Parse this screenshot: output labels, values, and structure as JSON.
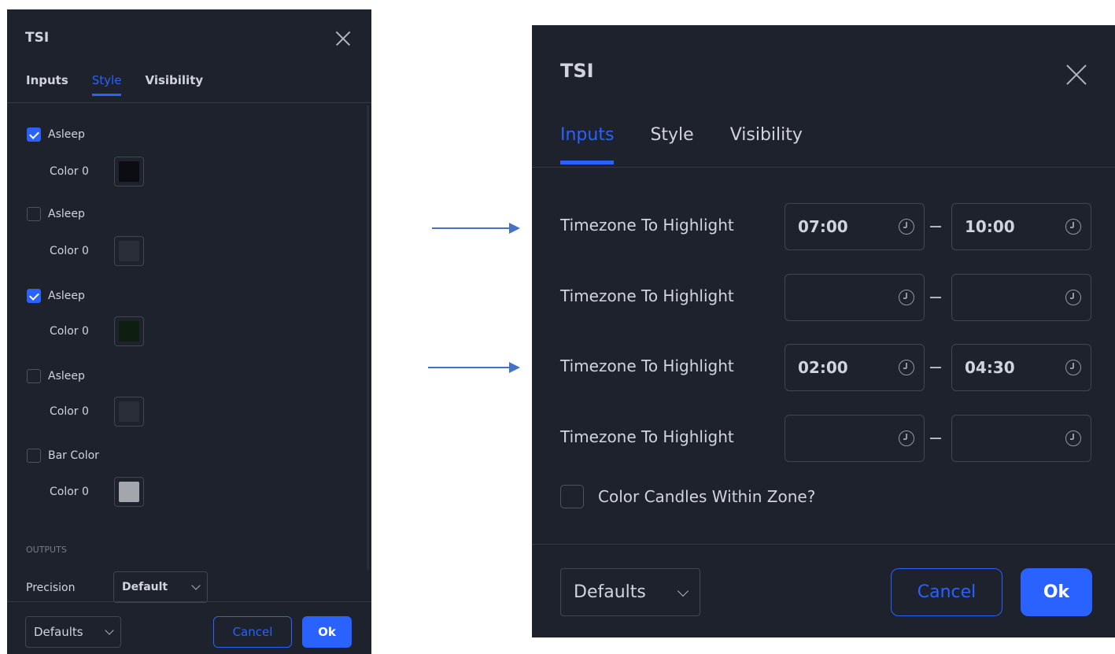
{
  "left_dialog": {
    "title": "TSI",
    "tabs": [
      {
        "label": "Inputs",
        "active": false
      },
      {
        "label": "Style",
        "active": true
      },
      {
        "label": "Visibility",
        "active": false
      }
    ],
    "plots": [
      {
        "label": "Asleep",
        "checked": true,
        "color_label": "Color 0",
        "swatch": "#0b0d12"
      },
      {
        "label": "Asleep",
        "checked": false,
        "color_label": "Color 0",
        "swatch": "#2a2e39"
      },
      {
        "label": "Asleep",
        "checked": true,
        "color_label": "Color 0",
        "swatch": "#0e1f12"
      },
      {
        "label": "Asleep",
        "checked": false,
        "color_label": "Color 0",
        "swatch": "#2a2e39"
      },
      {
        "label": "Bar Color",
        "checked": false,
        "color_label": "Color 0",
        "swatch": "#a3a6ad"
      }
    ],
    "outputs_heading": "OUTPUTS",
    "precision_label": "Precision",
    "precision_value": "Default",
    "footer": {
      "defaults": "Defaults",
      "cancel": "Cancel",
      "ok": "Ok"
    }
  },
  "right_dialog": {
    "title": "TSI",
    "tabs": [
      {
        "label": "Inputs",
        "active": true
      },
      {
        "label": "Style",
        "active": false
      },
      {
        "label": "Visibility",
        "active": false
      }
    ],
    "timezones": [
      {
        "label": "Timezone To Highlight",
        "from": "07:00",
        "to": "10:00"
      },
      {
        "label": "Timezone To Highlight",
        "from": "",
        "to": ""
      },
      {
        "label": "Timezone To Highlight",
        "from": "02:00",
        "to": "04:30"
      },
      {
        "label": "Timezone To Highlight",
        "from": "",
        "to": ""
      }
    ],
    "color_candles": {
      "label": "Color Candles Within Zone?",
      "checked": false
    },
    "footer": {
      "defaults": "Defaults",
      "cancel": "Cancel",
      "ok": "Ok"
    }
  },
  "colors": {
    "dialog_bg": "#1e222d",
    "accent": "#2962ff",
    "arrow": "#4472c4"
  }
}
